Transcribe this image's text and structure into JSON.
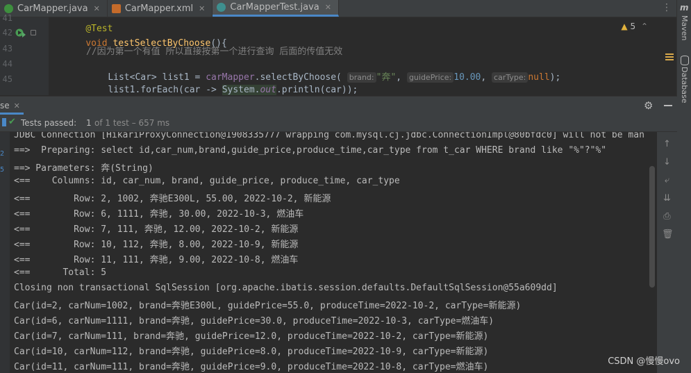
{
  "tabs": [
    {
      "label": "CarMapper.java",
      "icon": "java-class-icon"
    },
    {
      "label": "CarMapper.xml",
      "icon": "xml-file-icon"
    },
    {
      "label": "CarMapperTest.java",
      "icon": "test-class-icon"
    }
  ],
  "editor": {
    "line_numbers": [
      "41",
      "42",
      "43",
      "44",
      "45"
    ],
    "annotation": "@Test",
    "line42": {
      "kw": "void",
      "method": "testSelectByChoose",
      "rest": "(){"
    },
    "comment": "//因为第一个有值 所以直接按第一个进行查询 后面的传值无效",
    "line44": {
      "prefix": "List<Car> list1 = ",
      "field": "carMapper",
      "call": ".selectByChoose( ",
      "hint1": "brand:",
      "arg1": "\"奔\"",
      "hint2": "guidePrice:",
      "arg2": "10.00",
      "hint3": "carType:",
      "arg3": "null",
      "suffix": ");"
    },
    "line45": {
      "prefix": "list1.forEach(car -> ",
      "sys": "System.",
      "out": "out",
      "rest": ".println(car));"
    },
    "warnings": "5"
  },
  "right_strip": {
    "maven": "Maven",
    "database": "Database"
  },
  "run_panel": {
    "tab_label": "se"
  },
  "status": {
    "passed": "Tests passed:",
    "count": "1",
    "rest": "of 1 test – 657 ms"
  },
  "console_lines": [
    "JDBC Connection [HikariProxyConnection@1908335777 wrapping com.mysql.cj.jdbc.ConnectionImpl@80bfdc0] will not be man",
    "==>  Preparing: select id,car_num,brand,guide_price,produce_time,car_type from t_car WHERE brand like \"%\"?\"%\"",
    "==> Parameters: 奔(String)",
    "<==    Columns: id, car_num, brand, guide_price, produce_time, car_type",
    "<==        Row: 2, 1002, 奔驰E300L, 55.00, 2022-10-2, 新能源",
    "<==        Row: 6, 1111, 奔驰, 30.00, 2022-10-3, 燃油车",
    "<==        Row: 7, 111, 奔驰, 12.00, 2022-10-2, 新能源",
    "<==        Row: 10, 112, 奔驰, 8.00, 2022-10-9, 新能源",
    "<==        Row: 11, 111, 奔驰, 9.00, 2022-10-8, 燃油车",
    "<==      Total: 5",
    "Closing non transactional SqlSession [org.apache.ibatis.session.defaults.DefaultSqlSession@55a609dd]",
    "Car(id=2, carNum=1002, brand=奔驰E300L, guidePrice=55.0, produceTime=2022-10-2, carType=新能源)",
    "Car(id=6, carNum=1111, brand=奔驰, guidePrice=30.0, produceTime=2022-10-3, carType=燃油车)",
    "Car(id=7, carNum=111, brand=奔驰, guidePrice=12.0, produceTime=2022-10-2, carType=新能源)",
    "Car(id=10, carNum=112, brand=奔驰, guidePrice=8.0, produceTime=2022-10-9, carType=新能源)",
    "Car(id=11, carNum=111, brand=奔驰, guidePrice=9.0, produceTime=2022-10-8, carType=燃油车)"
  ],
  "watermark": "CSDN @慢慢ovo",
  "colors": {
    "accent": "#4a88c7",
    "pass_green": "#499c54",
    "bg": "#2b2b2b",
    "panel": "#3c3f41"
  }
}
